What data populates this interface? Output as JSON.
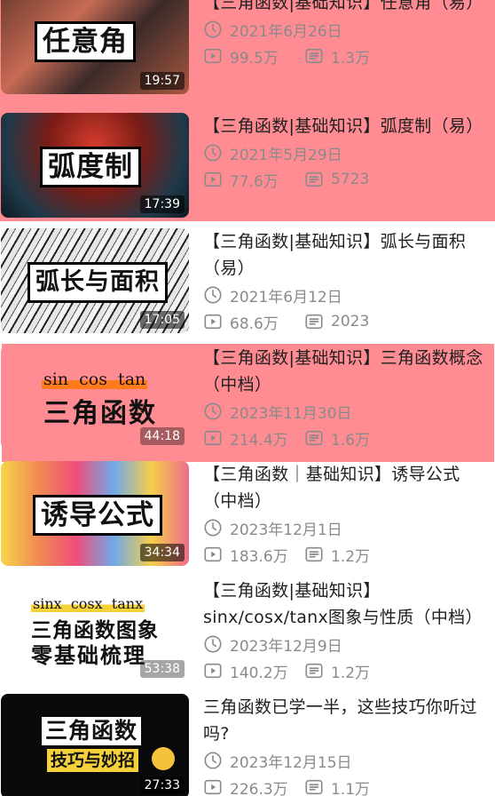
{
  "videos": [
    {
      "title": "【三角函数|基础知识】任意角（易）",
      "thumb_text": "任意角",
      "duration": "19:57",
      "date": "2021年6月26日",
      "views": "99.5万",
      "comments": "1.3万"
    },
    {
      "title": "【三角函数|基础知识】弧度制（易）",
      "thumb_text": "弧度制",
      "duration": "17:39",
      "date": "2021年5月29日",
      "views": "77.6万",
      "comments": "5723"
    },
    {
      "title": "【三角函数|基础知识】弧长与面积（易）",
      "thumb_text": "弧长与面积",
      "duration": "17:05",
      "date": "2021年6月12日",
      "views": "68.6万",
      "comments": "2023"
    },
    {
      "title": "【三角函数|基础知识】三角函数概念（中档）",
      "thumb_small": "sin  cos  tan",
      "thumb_text": "三角函数",
      "duration": "44:18",
      "date": "2023年11月30日",
      "views": "214.4万",
      "comments": "1.6万"
    },
    {
      "title": "【三角函数｜基础知识】诱导公式（中档）",
      "thumb_text": "诱导公式",
      "duration": "34:34",
      "date": "2023年12月1日",
      "views": "183.6万",
      "comments": "1.2万"
    },
    {
      "title": "【三角函数|基础知识】sinx/cosx/tanx图象与性质（中档）",
      "thumb_small": "sinx  cosx  tanx",
      "thumb_line1": "三角函数图象",
      "thumb_line2": "零基础梳理",
      "duration": "53:38",
      "date": "2023年12月9日",
      "views": "140.2万",
      "comments": "1.2万"
    },
    {
      "title": "三角函数已学一半，这些技巧你听过吗?",
      "thumb_line1": "三角函数",
      "thumb_line2": "技巧与妙招",
      "duration": "27:33",
      "date": "2023年12月15日",
      "views": "226.3万",
      "comments": "1.1万"
    }
  ],
  "icons": {
    "date": "clock-icon",
    "views": "play-icon",
    "comments": "comment-icon"
  },
  "colors": {
    "highlight": "#ff8c93",
    "meta_text": "#8a8a8a",
    "accent_orange": "#ff7a1a"
  }
}
